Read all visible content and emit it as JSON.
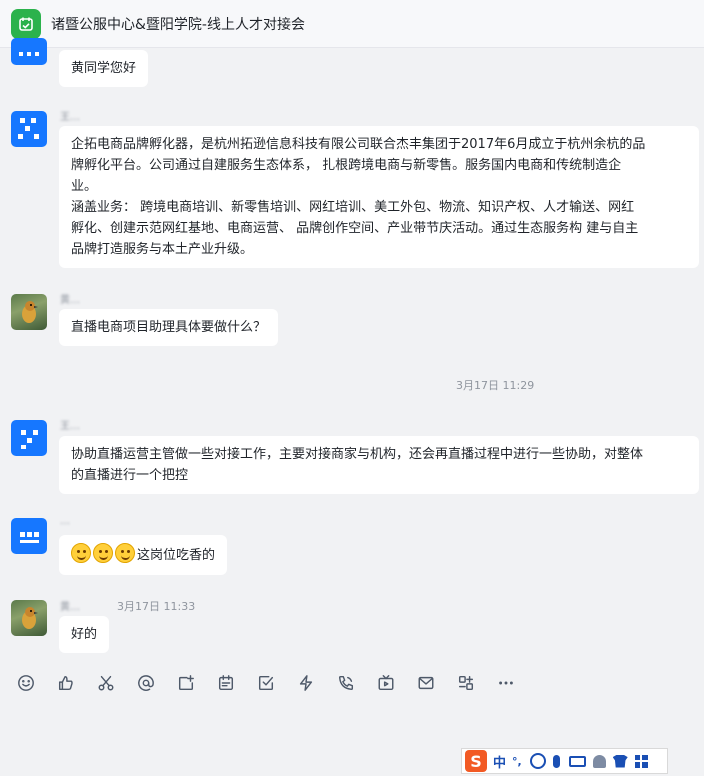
{
  "header": {
    "title": "诸暨公服中心&暨阳学院-线上人才对接会"
  },
  "messages": [
    {
      "text": "黄同学您好"
    },
    {
      "name": "王…",
      "lines": [
        "企拓电商品牌孵化器，是杭州拓逊信息科技有限公司联合杰丰集团于2017年6月成立于杭州余杭的品",
        "牌孵化平台。公司通过自建服务生态体系， 扎根跨境电商与新零售。服务国内电商和传统制造企",
        "业。",
        "涵盖业务： 跨境电商培训、新零售培训、网红培训、美工外包、物流、知识产权、人才输送、网红",
        "孵化、创建示范网红基地、电商运营、 品牌创作空间、产业带节庆活动。通过生态服务构 建与自主",
        "品牌打造服务与本土产业升级。"
      ]
    },
    {
      "name": "黄…",
      "text": "直播电商项目助理具体要做什么？"
    },
    {
      "center_time": "3月17日 11:29"
    },
    {
      "name": "王…",
      "lines": [
        "协助直播运营主管做一些对接工作，主要对接商家与机构，还会再直播过程中进行一些协助，对整体",
        "的直播进行一个把控"
      ]
    },
    {
      "name": "…",
      "text": "这岗位吃香的",
      "emoji_count": 3
    },
    {
      "name": "黄…",
      "time": "3月17日 11:33",
      "text": "好的"
    }
  ],
  "toolbar": [
    "emoji-icon",
    "thumbs-up-icon",
    "scissors-icon",
    "at-icon",
    "add-image-icon",
    "calendar-icon",
    "checkbox-icon",
    "lightning-icon",
    "voice-call-icon",
    "live-icon",
    "mail-icon",
    "apps-icon",
    "more-icon"
  ],
  "ime": {
    "chinese_label": "中",
    "punctuation": "°,"
  }
}
